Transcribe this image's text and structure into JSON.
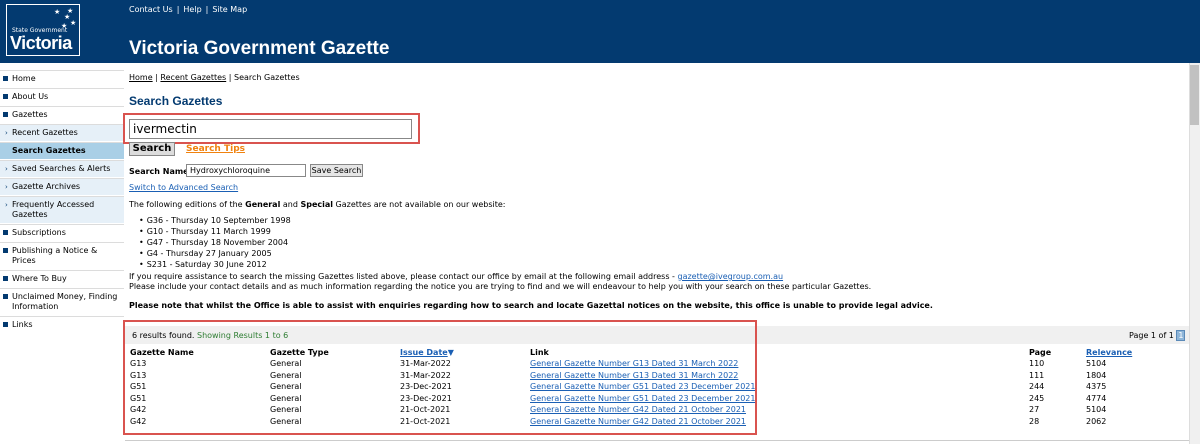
{
  "header": {
    "logo": {
      "small_text": "State Government",
      "main_text": "Victoria"
    },
    "top_links": [
      "Contact Us",
      "Help",
      "Site Map"
    ],
    "site_title": "Victoria Government Gazette"
  },
  "sidebar": {
    "items": [
      {
        "label": "Home"
      },
      {
        "label": "About Us"
      },
      {
        "label": "Gazettes"
      },
      {
        "label": "Recent Gazettes"
      },
      {
        "label": "Search Gazettes"
      },
      {
        "label": "Saved Searches & Alerts"
      },
      {
        "label": "Gazette Archives"
      },
      {
        "label": "Frequently Accessed Gazettes"
      },
      {
        "label": "Subscriptions"
      },
      {
        "label": "Publishing a Notice & Prices"
      },
      {
        "label": "Where To Buy"
      },
      {
        "label": "Unclaimed Money, Finding Information"
      },
      {
        "label": "Links"
      }
    ]
  },
  "breadcrumb": {
    "home": "Home",
    "recent": "Recent Gazettes",
    "current": "Search Gazettes",
    "separator": "|"
  },
  "page_title": "Search Gazettes",
  "search": {
    "value": "ivermectin",
    "button_label": "Search",
    "tips_label": "Search Tips",
    "search_name_label": "Search Name:",
    "search_name_value": "Hydroxychloroquine",
    "save_search_label": "Save Search",
    "advanced_link": "Switch to Advanced Search"
  },
  "editions": {
    "intro_prefix": "The following editions of the ",
    "general": "General",
    "and": " and ",
    "special": "Special",
    "intro_suffix": " Gazettes are not available on our website:",
    "items": [
      "G36 - Thursday 10 September 1998",
      "G10 - Thursday 11 March 1999",
      "G47 - Thursday 18 November 2004",
      "G4 - Thursday 27 January 2005",
      "S231 - Saturday 30 June 2012"
    ]
  },
  "assist": {
    "line1": "If you require assistance to search the missing Gazettes listed above, please contact our office by email at the following email address - ",
    "email": "gazette@ivegroup.com.au",
    "line2": "Please include your contact details and as much information regarding the notice you are trying to find and we will endeavour to help you with your search on these particular Gazettes."
  },
  "legal_note": "Please note that whilst the Office is able to assist with enquiries regarding how to search and locate Gazettal notices on the website, this office is unable to provide legal advice.",
  "results": {
    "count_text": "6 results found.",
    "showing_text": "Showing Results 1 to 6",
    "pager_text": "Page 1 of 1",
    "pager_current": "1",
    "columns": {
      "name": "Gazette Name",
      "type": "Gazette Type",
      "date": "Issue Date",
      "link": "Link",
      "page": "Page",
      "relevance": "Relevance"
    },
    "rows": [
      {
        "name": "G13",
        "type": "General",
        "date": "31-Mar-2022",
        "link": "General Gazette Number G13 Dated 31 March 2022",
        "page": "110",
        "relevance": "5104"
      },
      {
        "name": "G13",
        "type": "General",
        "date": "31-Mar-2022",
        "link": "General Gazette Number G13 Dated 31 March 2022",
        "page": "111",
        "relevance": "1804"
      },
      {
        "name": "G51",
        "type": "General",
        "date": "23-Dec-2021",
        "link": "General Gazette Number G51 Dated 23 December 2021",
        "page": "244",
        "relevance": "4375"
      },
      {
        "name": "G51",
        "type": "General",
        "date": "23-Dec-2021",
        "link": "General Gazette Number G51 Dated 23 December 2021",
        "page": "245",
        "relevance": "4774"
      },
      {
        "name": "G42",
        "type": "General",
        "date": "21-Oct-2021",
        "link": "General Gazette Number G42 Dated 21 October 2021",
        "page": "27",
        "relevance": "5104"
      },
      {
        "name": "G42",
        "type": "General",
        "date": "21-Oct-2021",
        "link": "General Gazette Number G42 Dated 21 October 2021",
        "page": "28",
        "relevance": "2062"
      }
    ]
  },
  "colors": {
    "header": "#033a70",
    "highlight": "#d9534f",
    "link": "#1a5fb4",
    "tips": "#f0820f",
    "showing": "#2e7d32"
  }
}
